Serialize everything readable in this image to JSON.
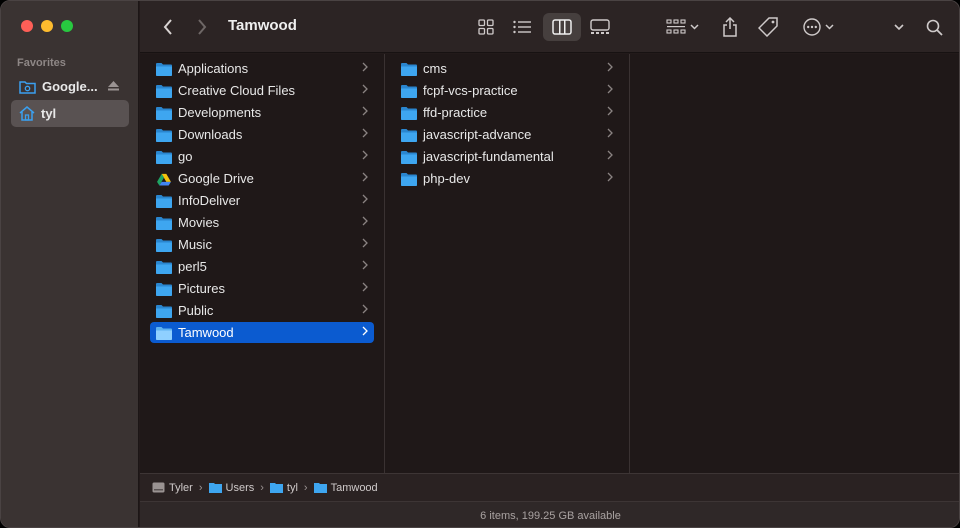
{
  "window": {
    "title": "Tamwood"
  },
  "sidebar": {
    "heading": "Favorites",
    "items": [
      {
        "label": "Google...",
        "icon": "drive-folder-icon"
      },
      {
        "label": "tyl",
        "icon": "home-icon"
      }
    ]
  },
  "columns": {
    "col1": [
      {
        "label": "Applications"
      },
      {
        "label": "Creative Cloud Files"
      },
      {
        "label": "Developments"
      },
      {
        "label": "Downloads"
      },
      {
        "label": "go"
      },
      {
        "label": "Google Drive"
      },
      {
        "label": "InfoDeliver"
      },
      {
        "label": "Movies"
      },
      {
        "label": "Music"
      },
      {
        "label": "perl5"
      },
      {
        "label": "Pictures"
      },
      {
        "label": "Public"
      },
      {
        "label": "Tamwood"
      }
    ],
    "col2": [
      {
        "label": "cms"
      },
      {
        "label": "fcpf-vcs-practice"
      },
      {
        "label": "ffd-practice"
      },
      {
        "label": "javascript-advance"
      },
      {
        "label": "javascript-fundamental"
      },
      {
        "label": "php-dev"
      }
    ]
  },
  "pathbar": [
    "Tyler",
    "Users",
    "tyl",
    "Tamwood"
  ],
  "status": "6 items, 199.25 GB available",
  "colors": {
    "selection": "#0b5bd0",
    "folder": "#3ea6f0",
    "sidebar_icon": "#3aa0f0"
  }
}
